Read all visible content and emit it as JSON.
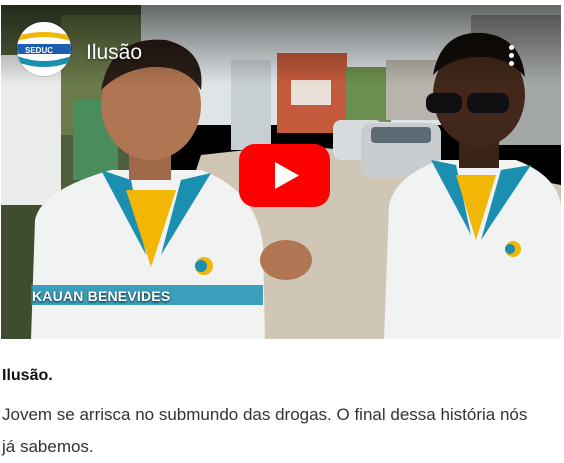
{
  "video": {
    "title": "Ilusão",
    "lower_third_name": "KAUAN BENEVIDES",
    "channel_logo_text": "SEDUC"
  },
  "caption": {
    "title": "Ilusão.",
    "description": "Jovem se arrisca no submundo das drogas. O final dessa história nós já sabemos."
  },
  "colors": {
    "play_button": "#ff0000",
    "uniform_collar": "#1b8fb0",
    "uniform_accent": "#f2b705"
  },
  "icons": {
    "play": "youtube-play-icon",
    "menu": "kebab-menu-icon"
  }
}
